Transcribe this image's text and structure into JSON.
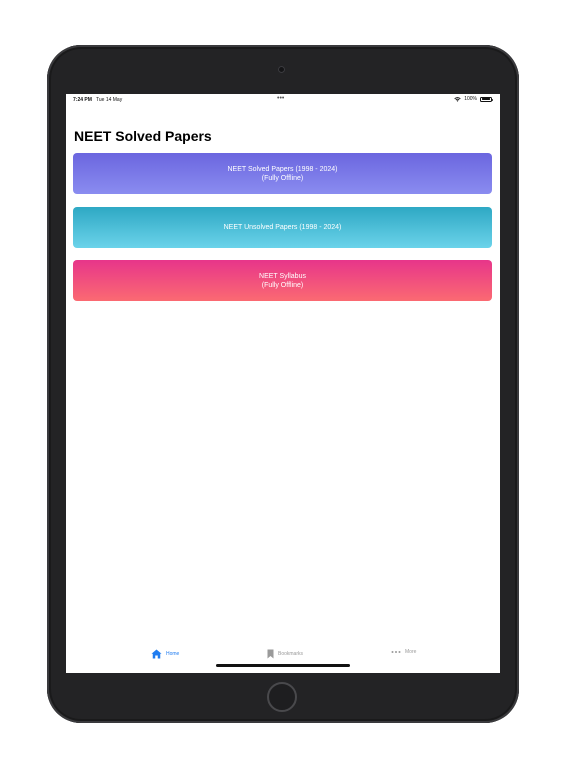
{
  "status_bar": {
    "time": "7:24 PM",
    "date": "Tue 14 May",
    "dots": "•••",
    "battery": "100%",
    "wifi_icon": "wifi-icon",
    "battery_icon": "battery-icon"
  },
  "page": {
    "title": "NEET Solved Papers"
  },
  "cards": {
    "solved": {
      "line1": "NEET Solved Papers (1998 - 2024)",
      "line2": "(Fully Offline)",
      "colors": [
        "#6b66df",
        "#8a8cf0"
      ]
    },
    "unsolved": {
      "line1": "NEET Unsolved Papers (1998 - 2024)",
      "colors": [
        "#2ea8c4",
        "#6bd3ea"
      ]
    },
    "syllabus": {
      "line1": "NEET Syllabus",
      "line2": "(Fully Offline)",
      "colors": [
        "#e7358a",
        "#fb6a72"
      ]
    }
  },
  "tab_bar": {
    "active_color": "#1f7cf0",
    "inactive_color": "#9a9a9a",
    "items": [
      {
        "label": "Home",
        "icon": "house-icon",
        "active": true
      },
      {
        "label": "Bookmarks",
        "icon": "bookmark-icon",
        "active": false
      },
      {
        "label": "More",
        "icon": "ellipsis-icon",
        "active": false
      }
    ]
  }
}
